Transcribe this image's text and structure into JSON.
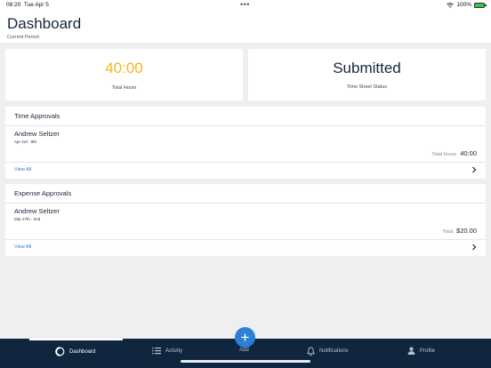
{
  "status_bar": {
    "time": "08:20",
    "date": "Tue Apr 5",
    "battery": "100%"
  },
  "header": {
    "title": "Dashboard",
    "subtitle": "Current Period"
  },
  "stats": {
    "total_hours_value": "40:00",
    "total_hours_label": "Total Hours",
    "status_value": "Submitted",
    "status_label": "Time Sheet Status"
  },
  "time_approvals": {
    "title": "Time Approvals",
    "name": "Andrew Seltzer",
    "date": "Apr 3rd - 9th",
    "total_label": "Total Hours",
    "total_value": "40:00",
    "view_all": "View All"
  },
  "expense_approvals": {
    "title": "Expense Approvals",
    "name": "Andrew Seltzer",
    "date": "Mar 27th - 2nd",
    "total_label": "Total",
    "total_value": "$20.00",
    "view_all": "View All"
  },
  "tabs": {
    "dashboard": "Dashboard",
    "activity": "Activity",
    "add": "Add",
    "notifications": "Notifications",
    "profile": "Profile"
  },
  "colors": {
    "accent_orange": "#f5b51e",
    "tabbar": "#10263f",
    "fab": "#2d7fd6",
    "link": "#2b7bd0"
  }
}
